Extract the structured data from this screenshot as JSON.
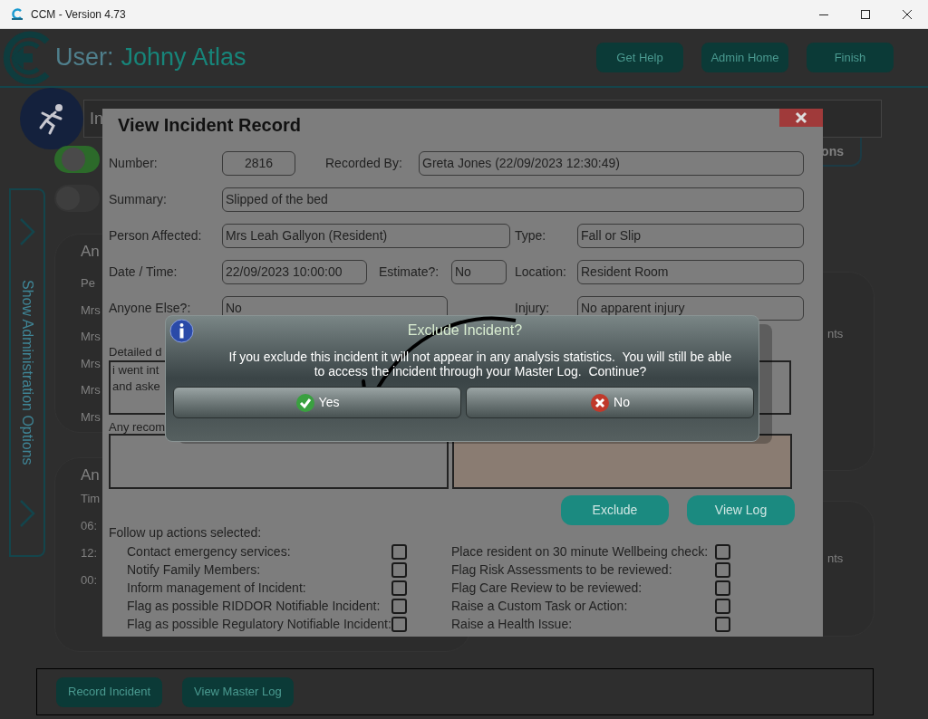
{
  "window": {
    "title": "CCM - Version 4.73"
  },
  "app": {
    "user_label": "User:",
    "user_name": "Johny Atlas",
    "header_buttons": [
      "Get Help",
      "Admin Home",
      "Finish"
    ],
    "panel_heading": "In",
    "options_button": "ons",
    "toggles": [
      {
        "on": true
      },
      {
        "on": false
      }
    ],
    "sidebar_tab": {
      "label": "Show Administration Options"
    },
    "left_panels": [
      {
        "title": "An",
        "lines": [
          "Pe",
          "Mrs",
          "Mrs",
          "Mrs",
          "Mrs",
          "Mrs"
        ]
      },
      {
        "title": "An",
        "lines": [
          "Tim",
          "06:",
          "12:",
          "00:"
        ]
      }
    ],
    "right_panels": [
      {
        "text": "nts"
      },
      {
        "text": "nts"
      }
    ],
    "bottom_buttons": [
      "Record Incident",
      "View Master Log"
    ]
  },
  "incident_record": {
    "title": "View Incident Record",
    "number_label": "Number:",
    "number": "2816",
    "recorded_by_label": "Recorded By:",
    "recorded_by": "Greta Jones (22/09/2023 12:30:49)",
    "summary_label": "Summary:",
    "summary": "Slipped of the bed",
    "person_label": "Person Affected:",
    "person": "Mrs Leah Gallyon (Resident)",
    "type_label": "Type:",
    "type": "Fall or Slip",
    "date_label": "Date / Time:",
    "date": "22/09/2023 10:00:00",
    "estimate_label": "Estimate?:",
    "estimate": "No",
    "location_label": "Location:",
    "location": "Resident Room",
    "anyone_label": "Anyone Else?:",
    "anyone": "No",
    "injury_label": "Injury:",
    "injury": "No apparent injury",
    "description_label": "Detailed d",
    "description_lines": [
      "i went int",
      "and aske"
    ],
    "recommendations_label": "Any recom",
    "buttons": [
      "Exclude",
      "View Log"
    ],
    "followup_label": "Follow up actions selected:",
    "actions_left": [
      {
        "label": "Contact emergency services:",
        "checked": false
      },
      {
        "label": "Notify Family Members:",
        "checked": false
      },
      {
        "label": "Inform management of Incident:",
        "checked": false
      },
      {
        "label": "Flag as possible RIDDOR Notifiable Incident:",
        "checked": false
      },
      {
        "label": "Flag as possible Regulatory Notifiable Incident:",
        "checked": false
      }
    ],
    "actions_right": [
      {
        "label": "Place resident on 30 minute Wellbeing check:",
        "checked": false
      },
      {
        "label": "Flag Risk Assessments to be reviewed:",
        "checked": false
      },
      {
        "label": "Flag Care Review to be reviewed:",
        "checked": false
      },
      {
        "label": "Raise a Custom Task or Action:",
        "checked": false
      },
      {
        "label": "Raise a Health Issue:",
        "checked": false
      }
    ]
  },
  "confirm_dialog": {
    "title": "Exclude Incident?",
    "message_lines": [
      "If you exclude this incident it will not appear in any analysis statistics.  You will still be able",
      "to access the incident through your Master Log.  Continue?"
    ],
    "buttons": [
      {
        "kind": "yes",
        "label": "Yes"
      },
      {
        "kind": "no",
        "label": "No"
      }
    ]
  }
}
